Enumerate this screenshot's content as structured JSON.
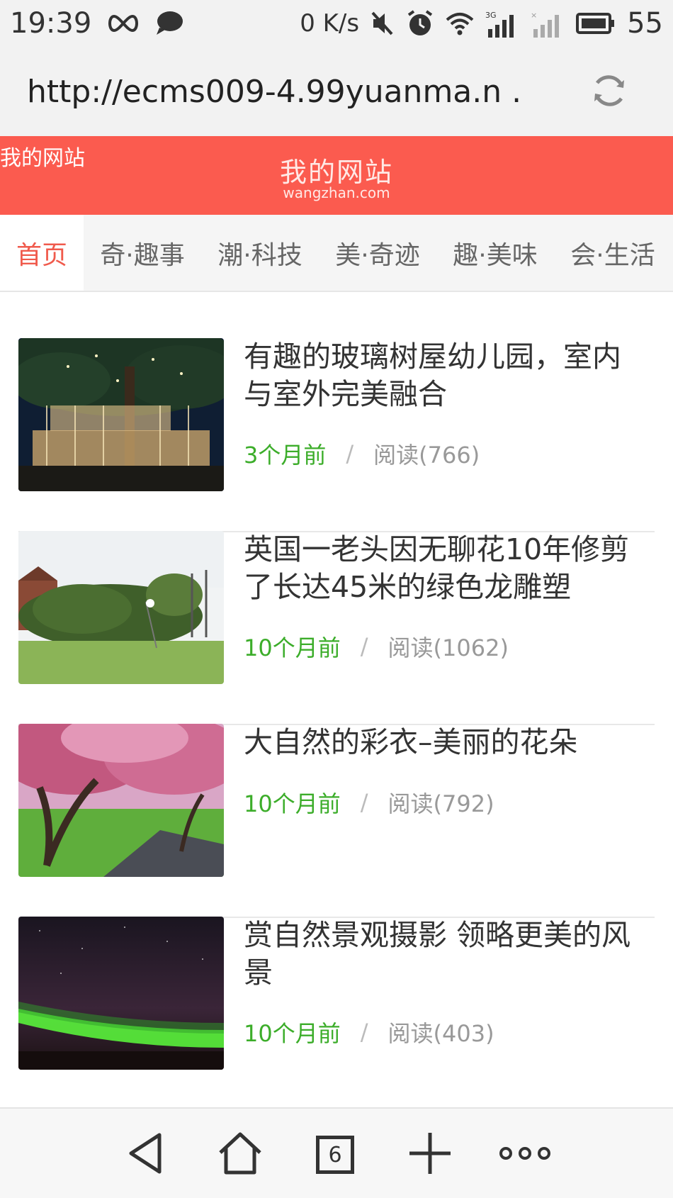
{
  "status_bar": {
    "time": "19:39",
    "speed": "0 K/s",
    "battery": "55"
  },
  "browser": {
    "url": "http://ecms009-4.99yuanma.n ..",
    "tab_count": "6"
  },
  "site": {
    "alt_text": "我的网站",
    "logo_title": "我的网站",
    "logo_subtitle": "wangzhan.com",
    "brand_color": "#fb5b4f"
  },
  "nav": {
    "tabs": [
      "首页",
      "奇·趣事",
      "潮·科技",
      "美·奇迹",
      "趣·美味",
      "会·生活"
    ],
    "active_index": 0
  },
  "articles": [
    {
      "title": "有趣的玻璃树屋幼儿园，室内与室外完美融合",
      "time": "3个月前",
      "reads": "阅读(766)",
      "sep": "/"
    },
    {
      "title": "英国一老头因无聊花10年修剪了长达45米的绿色龙雕塑",
      "time": "10个月前",
      "reads": "阅读(1062)",
      "sep": "/"
    },
    {
      "title": "大自然的彩衣–美丽的花朵",
      "time": "10个月前",
      "reads": "阅读(792)",
      "sep": "/"
    },
    {
      "title": "赏自然景观摄影 领略更美的风景",
      "time": "10个月前",
      "reads": "阅读(403)",
      "sep": "/"
    }
  ],
  "colors": {
    "accent_green": "#3cad2a",
    "active_tab": "#f05a4c"
  }
}
